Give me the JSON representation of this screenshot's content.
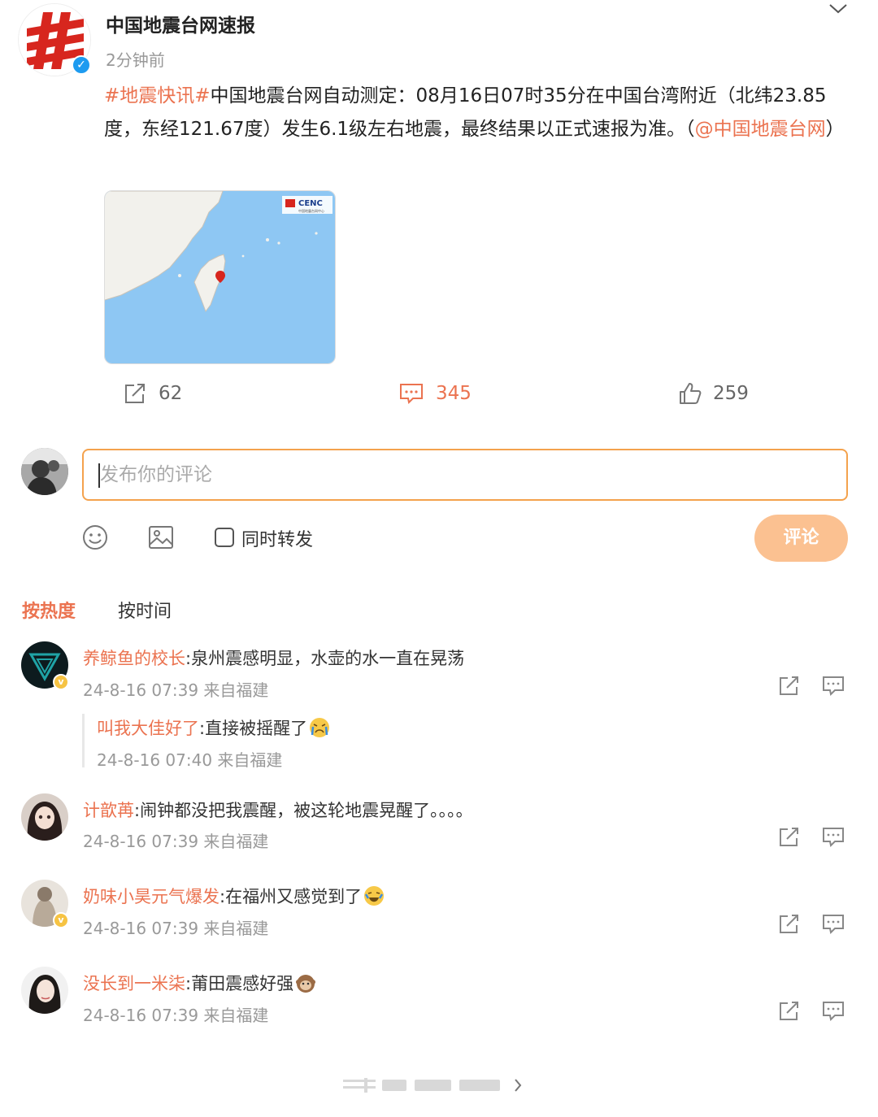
{
  "post": {
    "username": "中国地震台网速报",
    "time": "2分钟前",
    "hashtag": "#地震快讯#",
    "text_main": "中国地震台网自动测定：08月16日07时35分在中国台湾附近（北纬23.85度，东经121.67度）发生6.1级左右地震，最终结果以正式速报为准。（",
    "mention": "@中国地震台网",
    "text_end": "）",
    "map_logo": "CENC",
    "map_logo_sub": "中国地震台网中心"
  },
  "actions": {
    "repost_count": "62",
    "comment_count": "345",
    "like_count": "259"
  },
  "composer": {
    "placeholder": "发布你的评论",
    "forward_label": "同时转发",
    "submit_label": "评论"
  },
  "tabs": {
    "hot": "按热度",
    "time": "按时间"
  },
  "comments": [
    {
      "user": "养鲸鱼的校长",
      "text": ":泉州震感明显，水壶的水一直在晃荡",
      "meta": "24-8-16 07:39 来自福建",
      "reply": {
        "user": "叫我大佳好了",
        "text": ":直接被摇醒了",
        "meta": "24-8-16 07:40 来自福建"
      }
    },
    {
      "user": "计歆苒",
      "text": ":闹钟都没把我震醒，被这轮地震晃醒了。。。。",
      "meta": "24-8-16 07:39 来自福建"
    },
    {
      "user": "奶味小昊元气爆发",
      "text": ":在福州又感觉到了",
      "meta": "24-8-16 07:39 来自福建"
    },
    {
      "user": "没长到一米柒",
      "text": ":莆田震感好强",
      "meta": "24-8-16 07:39 来自福建"
    }
  ],
  "colors": {
    "accent": "#eb7350",
    "input_border": "#f4a24d",
    "submit_bg": "#fbc191",
    "verified": "#1d9bf0",
    "map_sea": "#8ec7f3",
    "land": "#f2f1ec"
  }
}
